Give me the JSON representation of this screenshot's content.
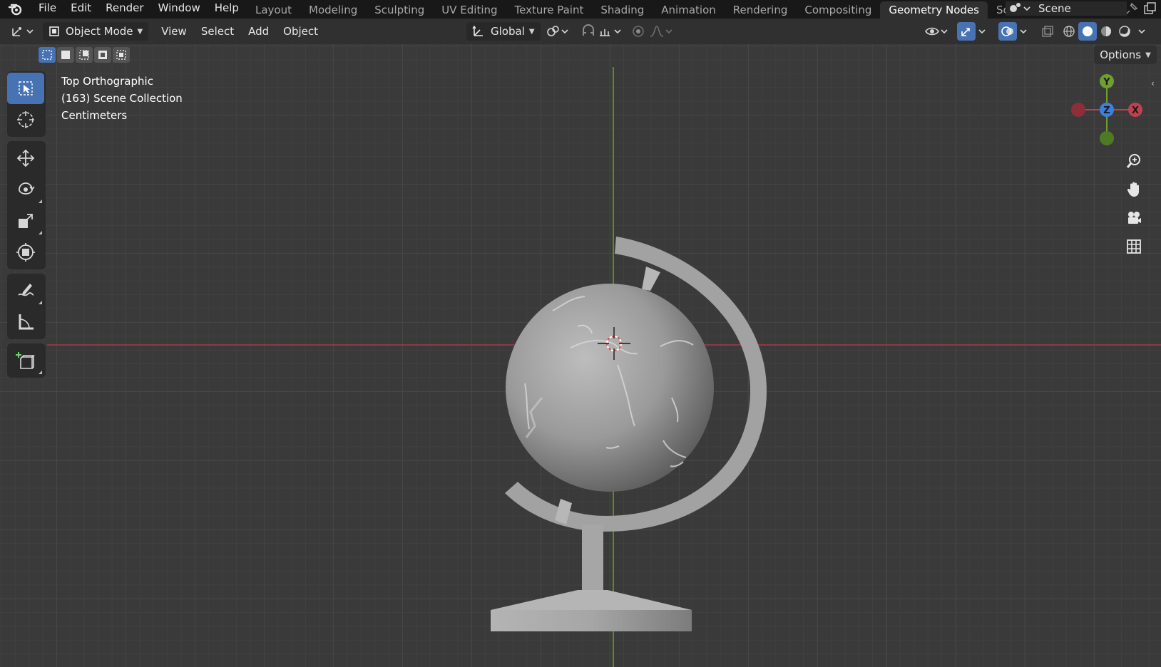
{
  "menubar": {
    "items": [
      "File",
      "Edit",
      "Render",
      "Window",
      "Help"
    ],
    "workspaces": [
      "Layout",
      "Modeling",
      "Sculpting",
      "UV Editing",
      "Texture Paint",
      "Shading",
      "Animation",
      "Rendering",
      "Compositing",
      "Geometry Nodes",
      "Scriptir"
    ],
    "active_workspace": "Geometry Nodes",
    "scene_name": "Scene"
  },
  "header": {
    "mode_label": "Object Mode",
    "menus": [
      "View",
      "Select",
      "Add",
      "Object"
    ],
    "transform_orientation": "Global",
    "options_label": "Options"
  },
  "viewport": {
    "view_name": "Top Orthographic",
    "collection": "(163) Scene Collection",
    "units": "Centimeters"
  },
  "gizmo": {
    "y_label": "Y",
    "z_label": "Z",
    "x_label": "X"
  },
  "colors": {
    "accent": "#4772b3",
    "axis_x": "#c1404d",
    "axis_y": "#6fa02d",
    "axis_z": "#3d7fdf"
  },
  "toolbar": {
    "tools": [
      "select-box-icon",
      "cursor-icon",
      "move-icon",
      "rotate-icon",
      "scale-icon",
      "transform-icon",
      "annotate-icon",
      "measure-icon",
      "add-cube-icon"
    ]
  }
}
